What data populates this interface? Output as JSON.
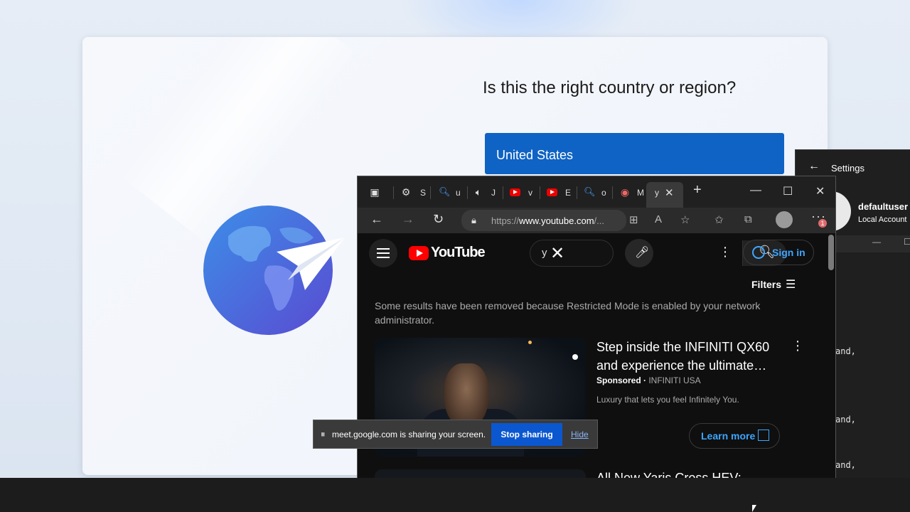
{
  "oobe": {
    "title": "Is this the right country or region?",
    "selected_country": "United States"
  },
  "settings_window": {
    "title": "Settings",
    "user_name": "defaultuser",
    "account_type": "Local Account",
    "terminal_lines": [
      "and,",
      "and,",
      "and,"
    ]
  },
  "browser": {
    "tabs": [
      {
        "icon": "settings-icon",
        "letter": "S"
      },
      {
        "icon": "search-icon",
        "letter": "u"
      },
      {
        "icon": "speaker-icon",
        "letter": "J"
      },
      {
        "icon": "youtube-icon",
        "letter": "v"
      },
      {
        "icon": "youtube-icon",
        "letter": "E"
      },
      {
        "icon": "search-icon",
        "letter": "o"
      },
      {
        "icon": "record-icon",
        "letter": "M"
      },
      {
        "icon": "active-tab",
        "letter": "y"
      }
    ],
    "url_prefix": "https://",
    "url_host": "www.youtube.com",
    "url_rest": "/...",
    "notification_count": "1"
  },
  "youtube": {
    "wordmark": "YouTube",
    "search_query": "y",
    "sign_in": "Sign in",
    "filters": "Filters",
    "restricted_notice": "Some results have been removed because Restricted Mode is enabled by your network administrator.",
    "ad": {
      "title": "Step inside the INFINITI QX60 and experience the ultimate…",
      "sponsored": "Sponsored",
      "advertiser": "INFINITI USA",
      "description": "Luxury that lets you feel Infinitely You.",
      "cta": "Learn more"
    },
    "next_title": "All New Yaris Cross HEV:"
  },
  "share_bar": {
    "message": "meet.google.com is sharing your screen.",
    "stop": "Stop sharing",
    "hide": "Hide"
  },
  "colors": {
    "oobe_accent": "#0f63c4",
    "youtube_red": "#ff0000",
    "link_blue": "#3ea6ff",
    "meet_blue": "#0b57d0"
  }
}
